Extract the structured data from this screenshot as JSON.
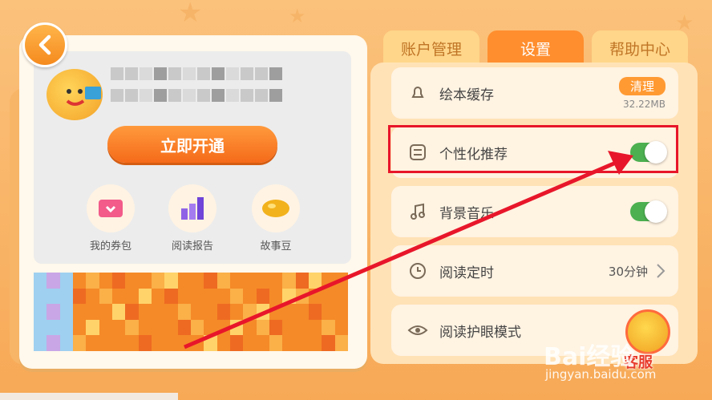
{
  "tabs": [
    {
      "label": "账户管理",
      "active": false
    },
    {
      "label": "设置",
      "active": true
    },
    {
      "label": "帮助中心",
      "active": false
    }
  ],
  "profile": {
    "open_button": "立即开通",
    "quick_actions": [
      {
        "label": "我的券包",
        "icon": "ticket-icon"
      },
      {
        "label": "阅读报告",
        "icon": "report-chart-icon"
      },
      {
        "label": "故事豆",
        "icon": "bean-icon"
      }
    ]
  },
  "settings": {
    "cache": {
      "label": "绘本缓存",
      "clean_label": "清理",
      "size": "32.22MB"
    },
    "personal": {
      "label": "个性化推荐",
      "enabled": true
    },
    "music": {
      "label": "背景音乐",
      "enabled": true
    },
    "timer": {
      "label": "阅读定时",
      "value": "30分钟"
    },
    "eye": {
      "label": "阅读护眼模式"
    }
  },
  "customer_service": {
    "label": "客服"
  },
  "watermark": {
    "main": "Bai经验",
    "sub": "jingyan.baidu.com"
  },
  "colors": {
    "accent": "#ff8e2e",
    "toggle_on": "#4cb050",
    "highlight": "#e8162a"
  }
}
